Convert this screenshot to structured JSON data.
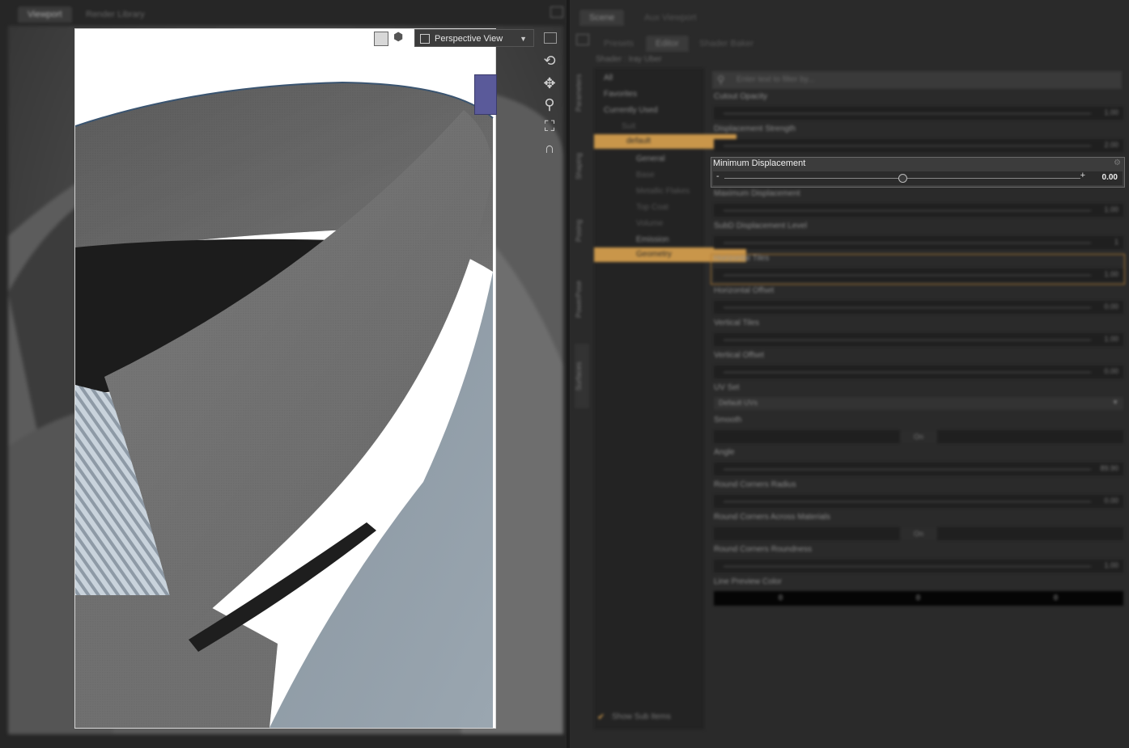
{
  "viewport_pane": {
    "tabs": [
      "Viewport",
      "Render Library"
    ],
    "camera_label": "Perspective View"
  },
  "right_pane": {
    "top_tabs": [
      "Scene",
      "Aux Viewport"
    ],
    "sub_tabs": [
      "Presets",
      "Editor",
      "Shader Baker"
    ],
    "shader_label": "Shader : Iray Uber",
    "side_tabs": [
      "Parameters",
      "Shaping",
      "Posing",
      "PowerPose",
      "Surfaces"
    ],
    "filter_placeholder": "Enter text to filter by...",
    "tree": [
      {
        "label": "All",
        "depth": 0,
        "selected": false
      },
      {
        "label": "Favorites",
        "depth": 0,
        "selected": false
      },
      {
        "label": "Currently Used",
        "depth": 0,
        "selected": false
      },
      {
        "label": "Suit",
        "depth": 0,
        "selected": false
      },
      {
        "label": "default",
        "depth": 1,
        "selected": true
      },
      {
        "label": "General",
        "depth": 2,
        "selected": false
      },
      {
        "label": "Base",
        "depth": 2,
        "selected": false
      },
      {
        "label": "Metallic Flakes",
        "depth": 2,
        "selected": false
      },
      {
        "label": "Top Coat",
        "depth": 2,
        "selected": false
      },
      {
        "label": "Volume",
        "depth": 2,
        "selected": false
      },
      {
        "label": "Emission",
        "depth": 2,
        "selected": false
      },
      {
        "label": "Geometry",
        "depth": 2,
        "selected": true
      }
    ],
    "show_sub_items": "Show Sub Items",
    "properties": [
      {
        "label": "Cutout Opacity",
        "value": "1.00",
        "type": "slider"
      },
      {
        "label": "Displacement Strength",
        "value": "2.00",
        "type": "slider"
      },
      {
        "label": "Minimum Displacement",
        "value": "0.00",
        "type": "slider",
        "active": true
      },
      {
        "label": "Maximum Displacement",
        "value": "1.00",
        "type": "slider"
      },
      {
        "label": "SubD Displacement Level",
        "value": "1",
        "type": "slider"
      },
      {
        "label": "Horizontal Tiles",
        "value": "1.00",
        "type": "slider",
        "highlight": true
      },
      {
        "label": "Horizontal Offset",
        "value": "0.00",
        "type": "slider"
      },
      {
        "label": "Vertical Tiles",
        "value": "1.00",
        "type": "slider"
      },
      {
        "label": "Vertical Offset",
        "value": "0.00",
        "type": "slider"
      },
      {
        "label": "UV Set",
        "value": "Default UVs",
        "type": "dropdown"
      },
      {
        "label": "Smooth",
        "value": "On",
        "type": "toggle"
      },
      {
        "label": "Angle",
        "value": "89.90",
        "type": "slider"
      },
      {
        "label": "Round Corners Radius",
        "value": "0.00",
        "type": "slider"
      },
      {
        "label": "Round Corners Across Materials",
        "value": "On",
        "type": "toggle"
      },
      {
        "label": "Round Corners Roundness",
        "value": "1.00",
        "type": "slider"
      },
      {
        "label": "Line Preview Color",
        "value": [
          "0",
          "0",
          "0"
        ],
        "type": "color"
      }
    ]
  },
  "colors": {
    "accent": "#c9964a",
    "panel": "#2a2a2a",
    "field": "#1f1f1f"
  }
}
